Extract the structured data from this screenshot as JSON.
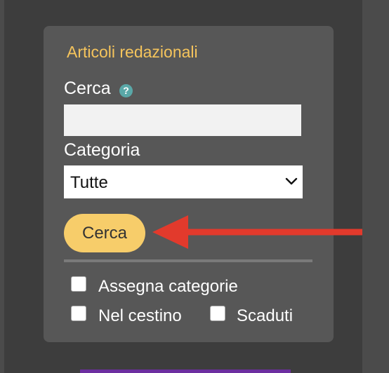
{
  "colors": {
    "page_bg": "#3d3d3d",
    "panel_bg": "#575757",
    "title_color": "#f5c45c",
    "button_bg": "#f7cd6a",
    "annotation_arrow": "#e23a2c"
  },
  "panel": {
    "title": "Articoli redazionali",
    "search": {
      "label": "Cerca",
      "help_icon": "question-mark-icon",
      "help_glyph": "?",
      "value": "",
      "placeholder": ""
    },
    "category": {
      "label": "Categoria",
      "selected": "Tutte"
    },
    "search_button": "Cerca",
    "options": [
      {
        "label": "Assegna categorie",
        "checked": false
      },
      {
        "label": "Nel cestino",
        "checked": false
      },
      {
        "label": "Scaduti",
        "checked": false
      }
    ]
  }
}
